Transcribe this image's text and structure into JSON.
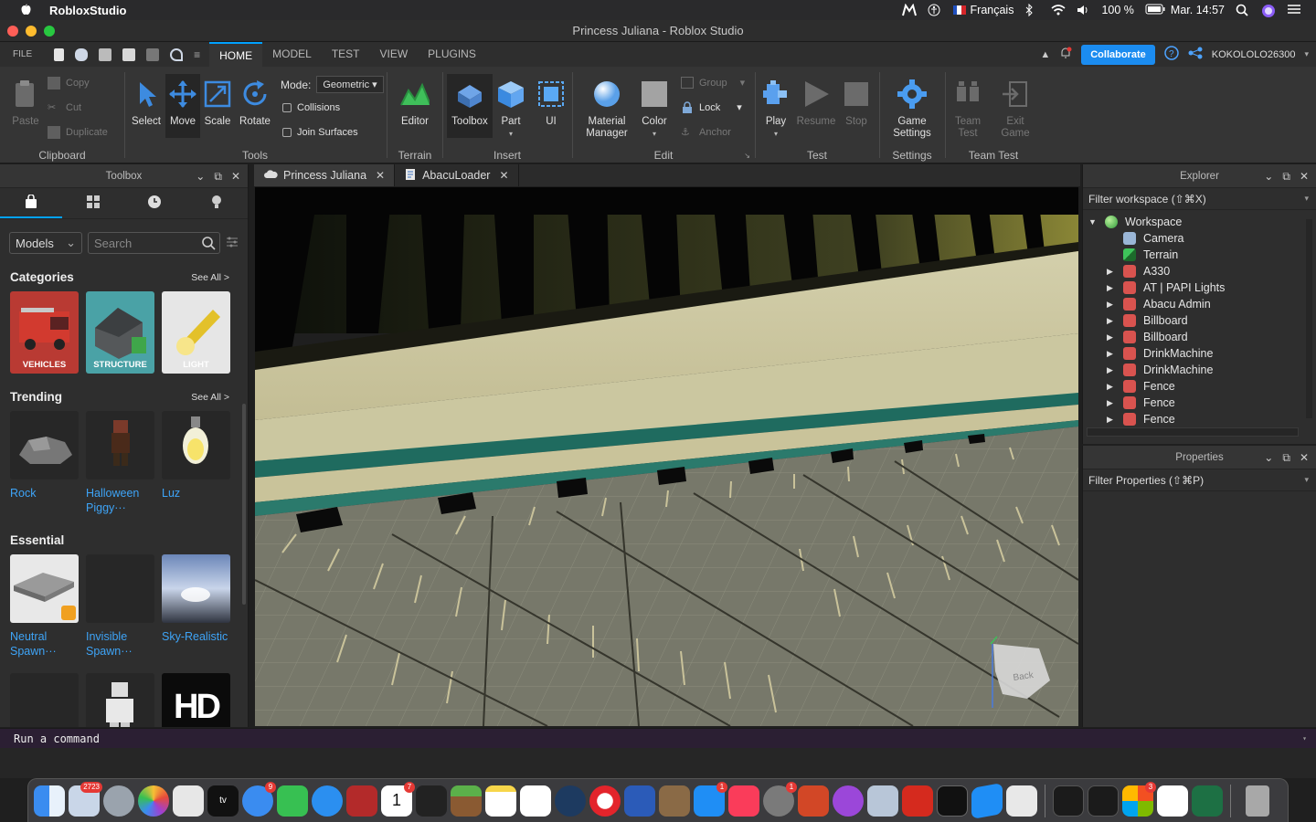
{
  "menubar": {
    "app_name": "RobloxStudio",
    "input_source": "Français",
    "battery": "100 %",
    "clock": "Mar. 14:57"
  },
  "window": {
    "title": "Princess Juliana - Roblox Studio"
  },
  "ribbon_tabs": {
    "file": "FILE",
    "tabs": [
      "HOME",
      "MODEL",
      "TEST",
      "VIEW",
      "PLUGINS"
    ],
    "active": "HOME",
    "collaborate": "Collaborate",
    "username": "KOKOLOLO26300"
  },
  "ribbon": {
    "clipboard": {
      "label": "Clipboard",
      "paste": "Paste",
      "copy": "Copy",
      "cut": "Cut",
      "duplicate": "Duplicate"
    },
    "tools": {
      "label": "Tools",
      "select": "Select",
      "move": "Move",
      "scale": "Scale",
      "rotate": "Rotate",
      "mode_label": "Mode:",
      "mode_value": "Geometric",
      "collisions": "Collisions",
      "join_surfaces": "Join Surfaces"
    },
    "terrain": {
      "label": "Terrain",
      "editor": "Editor"
    },
    "insert": {
      "label": "Insert",
      "toolbox": "Toolbox",
      "part": "Part",
      "ui": "UI"
    },
    "edit": {
      "label": "Edit",
      "material_manager_1": "Material",
      "material_manager_2": "Manager",
      "color": "Color",
      "group": "Group",
      "lock": "Lock",
      "anchor": "Anchor"
    },
    "test": {
      "label": "Test",
      "play": "Play",
      "resume": "Resume",
      "stop": "Stop"
    },
    "settings": {
      "label": "Settings",
      "game_settings_1": "Game",
      "game_settings_2": "Settings"
    },
    "team_test": {
      "label": "Team Test",
      "team_test_1": "Team",
      "team_test_2": "Test",
      "exit_game_1": "Exit",
      "exit_game_2": "Game"
    }
  },
  "toolbox": {
    "title": "Toolbox",
    "category_select": "Models",
    "search_placeholder": "Search",
    "categories_title": "Categories",
    "see_all": "See All >",
    "categories": [
      "VEHICLES",
      "STRUCTURE",
      "LIGHT"
    ],
    "trending_title": "Trending",
    "trending": [
      {
        "name1": "Rock",
        "name2": ""
      },
      {
        "name1": "Halloween",
        "name2": "Piggy···"
      },
      {
        "name1": "Luz",
        "name2": ""
      }
    ],
    "essential_title": "Essential",
    "essential": [
      {
        "name1": "Neutral",
        "name2": "Spawn···"
      },
      {
        "name1": "Invisible",
        "name2": "Spawn···"
      },
      {
        "name1": "Sky-Realistic",
        "name2": ""
      }
    ],
    "hd_label": "HD"
  },
  "doc_tabs": [
    "Princess Juliana",
    "AbacuLoader"
  ],
  "viewport": {
    "view_cube_label": "Back"
  },
  "explorer": {
    "title": "Explorer",
    "filter": "Filter workspace (⇧⌘X)",
    "items": [
      {
        "label": "Workspace",
        "depth": 0,
        "expanded": true,
        "icon": "globe"
      },
      {
        "label": "Camera",
        "depth": 1,
        "expanded": false,
        "icon": "camera"
      },
      {
        "label": "Terrain",
        "depth": 1,
        "expanded": false,
        "icon": "terrain"
      },
      {
        "label": "A330",
        "depth": 1,
        "expanded": false,
        "icon": "model"
      },
      {
        "label": "AT | PAPI Lights",
        "depth": 1,
        "expanded": false,
        "icon": "model"
      },
      {
        "label": "Abacu Admin",
        "depth": 1,
        "expanded": false,
        "icon": "model"
      },
      {
        "label": "Billboard",
        "depth": 1,
        "expanded": false,
        "icon": "model"
      },
      {
        "label": "Billboard",
        "depth": 1,
        "expanded": false,
        "icon": "model"
      },
      {
        "label": "DrinkMachine",
        "depth": 1,
        "expanded": false,
        "icon": "model"
      },
      {
        "label": "DrinkMachine",
        "depth": 1,
        "expanded": false,
        "icon": "model"
      },
      {
        "label": "Fence",
        "depth": 1,
        "expanded": false,
        "icon": "model"
      },
      {
        "label": "Fence",
        "depth": 1,
        "expanded": false,
        "icon": "model"
      },
      {
        "label": "Fence",
        "depth": 1,
        "expanded": false,
        "icon": "model"
      }
    ]
  },
  "properties": {
    "title": "Properties",
    "filter": "Filter Properties (⇧⌘P)"
  },
  "command_bar": {
    "placeholder": "Run a command"
  },
  "dock": {
    "badges": {
      "photos": "2723",
      "messages": "9",
      "calendar_day": "1",
      "calendar_badge": "7",
      "appstore": "1",
      "sysprefs": "1",
      "teams": "3"
    }
  },
  "colors": {
    "accent": "#00a2ff",
    "collaborate": "#1b8cf0",
    "link": "#3ea4f7"
  }
}
